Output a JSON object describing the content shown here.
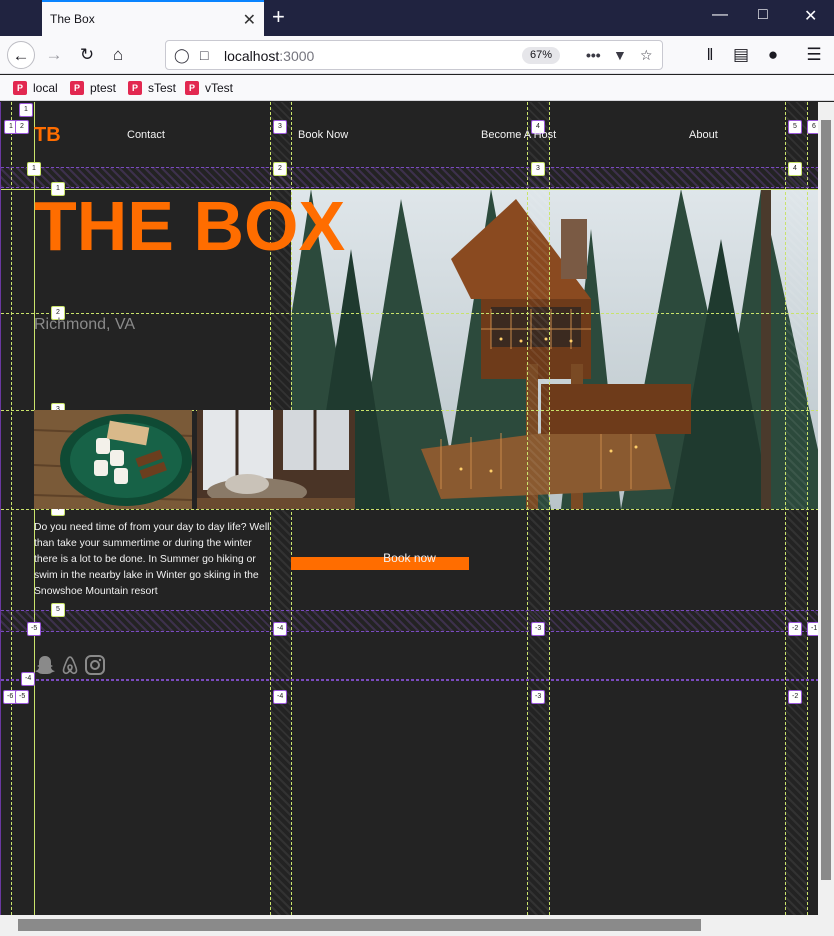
{
  "browser": {
    "tab_title": "The Box",
    "close_glyph": "✕",
    "new_tab_glyph": "+",
    "url_host": "localhost",
    "url_port": ":3000",
    "zoom": "67%",
    "bookmarks": [
      {
        "label": "local"
      },
      {
        "label": "ptest"
      },
      {
        "label": "sTest"
      },
      {
        "label": "vTest"
      }
    ]
  },
  "site": {
    "logo": "TB",
    "nav": [
      "Contact",
      "Book Now",
      "Become A Host",
      "About"
    ],
    "hero_title": "THE BOX",
    "location": "Richmond, VA",
    "description": "Do you need time of from your day to day life? Well than take your summertime or during the winter there is a lot to be done. In Summer go hiking or swim in the nearby lake in Winter go skiing in the Snowshoe Mountain resort",
    "book_button": "Book now",
    "social_icons": [
      "snapchat-icon",
      "airbnb-icon",
      "instagram-icon"
    ]
  },
  "grid_overlay": {
    "column_lines": [
      "1",
      "2",
      "3",
      "4",
      "5",
      "6"
    ],
    "row_lines": [
      "1",
      "2",
      "3",
      "4",
      "5"
    ],
    "negative_column_lines": [
      "-6",
      "-5",
      "-4",
      "-3",
      "-2",
      "-1"
    ],
    "negative_row_lines": [
      "-5",
      "-4"
    ]
  },
  "colors": {
    "accent": "#ff6d00",
    "page_bg": "#232323",
    "grid_line": "#c9e36b",
    "grid_gap": "#7a4ac0"
  }
}
